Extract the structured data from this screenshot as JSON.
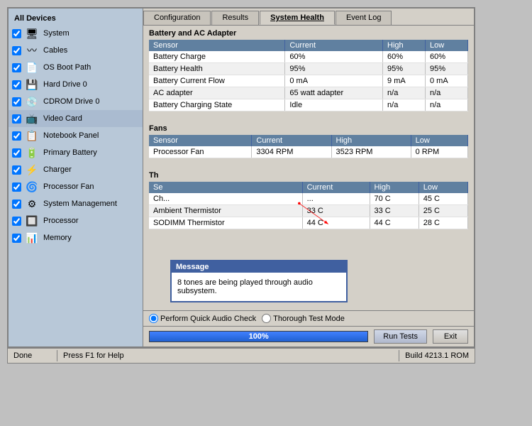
{
  "sidebar": {
    "header": "All Devices",
    "items": [
      {
        "label": "System",
        "icon": "🖥",
        "checked": true
      },
      {
        "label": "Cables",
        "icon": "〰",
        "checked": true
      },
      {
        "label": "OS Boot Path",
        "icon": "📄",
        "checked": true
      },
      {
        "label": "Hard Drive 0",
        "icon": "💾",
        "checked": true
      },
      {
        "label": "CDROM Drive 0",
        "icon": "💿",
        "checked": true
      },
      {
        "label": "Video Card",
        "icon": "📺",
        "checked": true,
        "selected": true
      },
      {
        "label": "Notebook Panel",
        "icon": "📋",
        "checked": true
      },
      {
        "label": "Primary Battery",
        "icon": "🔋",
        "checked": true
      },
      {
        "label": "Charger",
        "icon": "⚡",
        "checked": true
      },
      {
        "label": "Processor Fan",
        "icon": "🌀",
        "checked": true
      },
      {
        "label": "System Management",
        "icon": "⚙",
        "checked": true
      },
      {
        "label": "Processor",
        "icon": "🔲",
        "checked": true
      },
      {
        "label": "Memory",
        "icon": "📊",
        "checked": true
      }
    ]
  },
  "tabs": [
    {
      "label": "Configuration"
    },
    {
      "label": "Results"
    },
    {
      "label": "System Health",
      "active": true
    },
    {
      "label": "Event Log"
    }
  ],
  "battery_section": {
    "title": "Battery and AC Adapter",
    "columns": [
      "Sensor",
      "Current",
      "High",
      "Low"
    ],
    "rows": [
      [
        "Battery Charge",
        "60%",
        "60%",
        "60%"
      ],
      [
        "Battery Health",
        "95%",
        "95%",
        "95%"
      ],
      [
        "Battery Current Flow",
        "0 mA",
        "9 mA",
        "0 mA"
      ],
      [
        "AC adapter",
        "65 watt adapter",
        "n/a",
        "n/a"
      ],
      [
        "Battery Charging State",
        "Idle",
        "n/a",
        "n/a"
      ]
    ]
  },
  "fans_section": {
    "title": "Fans",
    "columns": [
      "Sensor",
      "Current",
      "High",
      "Low"
    ],
    "rows": [
      [
        "Processor Fan",
        "3304 RPM",
        "3523 RPM",
        "0 RPM"
      ]
    ]
  },
  "thermal_section": {
    "title": "Th",
    "columns": [
      "Se",
      "Current",
      "High",
      "Low"
    ],
    "rows": [
      [
        "Ch...",
        "...",
        "70 C",
        "45 C"
      ],
      [
        "Ambient Thermistor",
        "33 C",
        "33 C",
        "25 C"
      ],
      [
        "SODIMM Thermistor",
        "44 C",
        "44 C",
        "28 C"
      ]
    ]
  },
  "message_popup": {
    "title": "Message",
    "body": "8 tones are being played through audio subsystem."
  },
  "radio_options": [
    {
      "label": "Perform Quick Audio Check",
      "checked": true
    },
    {
      "label": "Thorough Test Mode",
      "checked": false
    }
  ],
  "progress": {
    "value": 100,
    "label": "100%"
  },
  "buttons": {
    "run": "Run Tests",
    "exit": "Exit"
  },
  "status": {
    "left": "Done",
    "help": "Press F1 for Help",
    "right": "Build  4213.1 ROM"
  }
}
